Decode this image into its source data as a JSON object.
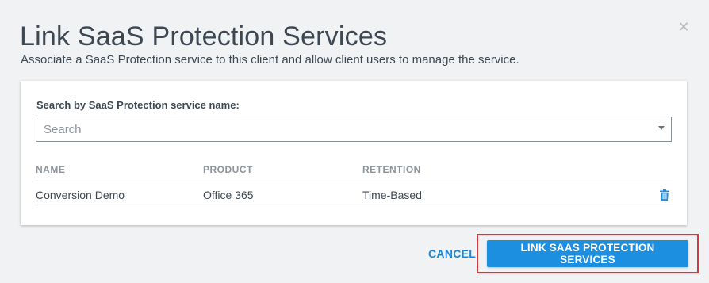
{
  "dialog": {
    "title": "Link SaaS Protection Services",
    "subtitle": "Associate a SaaS Protection service to this client and allow client users to manage the service.",
    "close_icon": "close-icon"
  },
  "search": {
    "label": "Search by SaaS Protection service name:",
    "placeholder": "Search",
    "value": ""
  },
  "table": {
    "columns": [
      "NAME",
      "PRODUCT",
      "RETENTION"
    ],
    "rows": [
      {
        "name": "Conversion Demo",
        "product": "Office 365",
        "retention": "Time-Based",
        "action_icon": "trash-icon"
      }
    ]
  },
  "footer": {
    "cancel_label": "CANCEL",
    "submit_label": "LINK SAAS PROTECTION SERVICES"
  },
  "colors": {
    "accent": "#1d8fe0",
    "text": "#3d4853",
    "muted": "#8d949c",
    "highlight": "#d0393e",
    "background": "#f1f2f4"
  }
}
